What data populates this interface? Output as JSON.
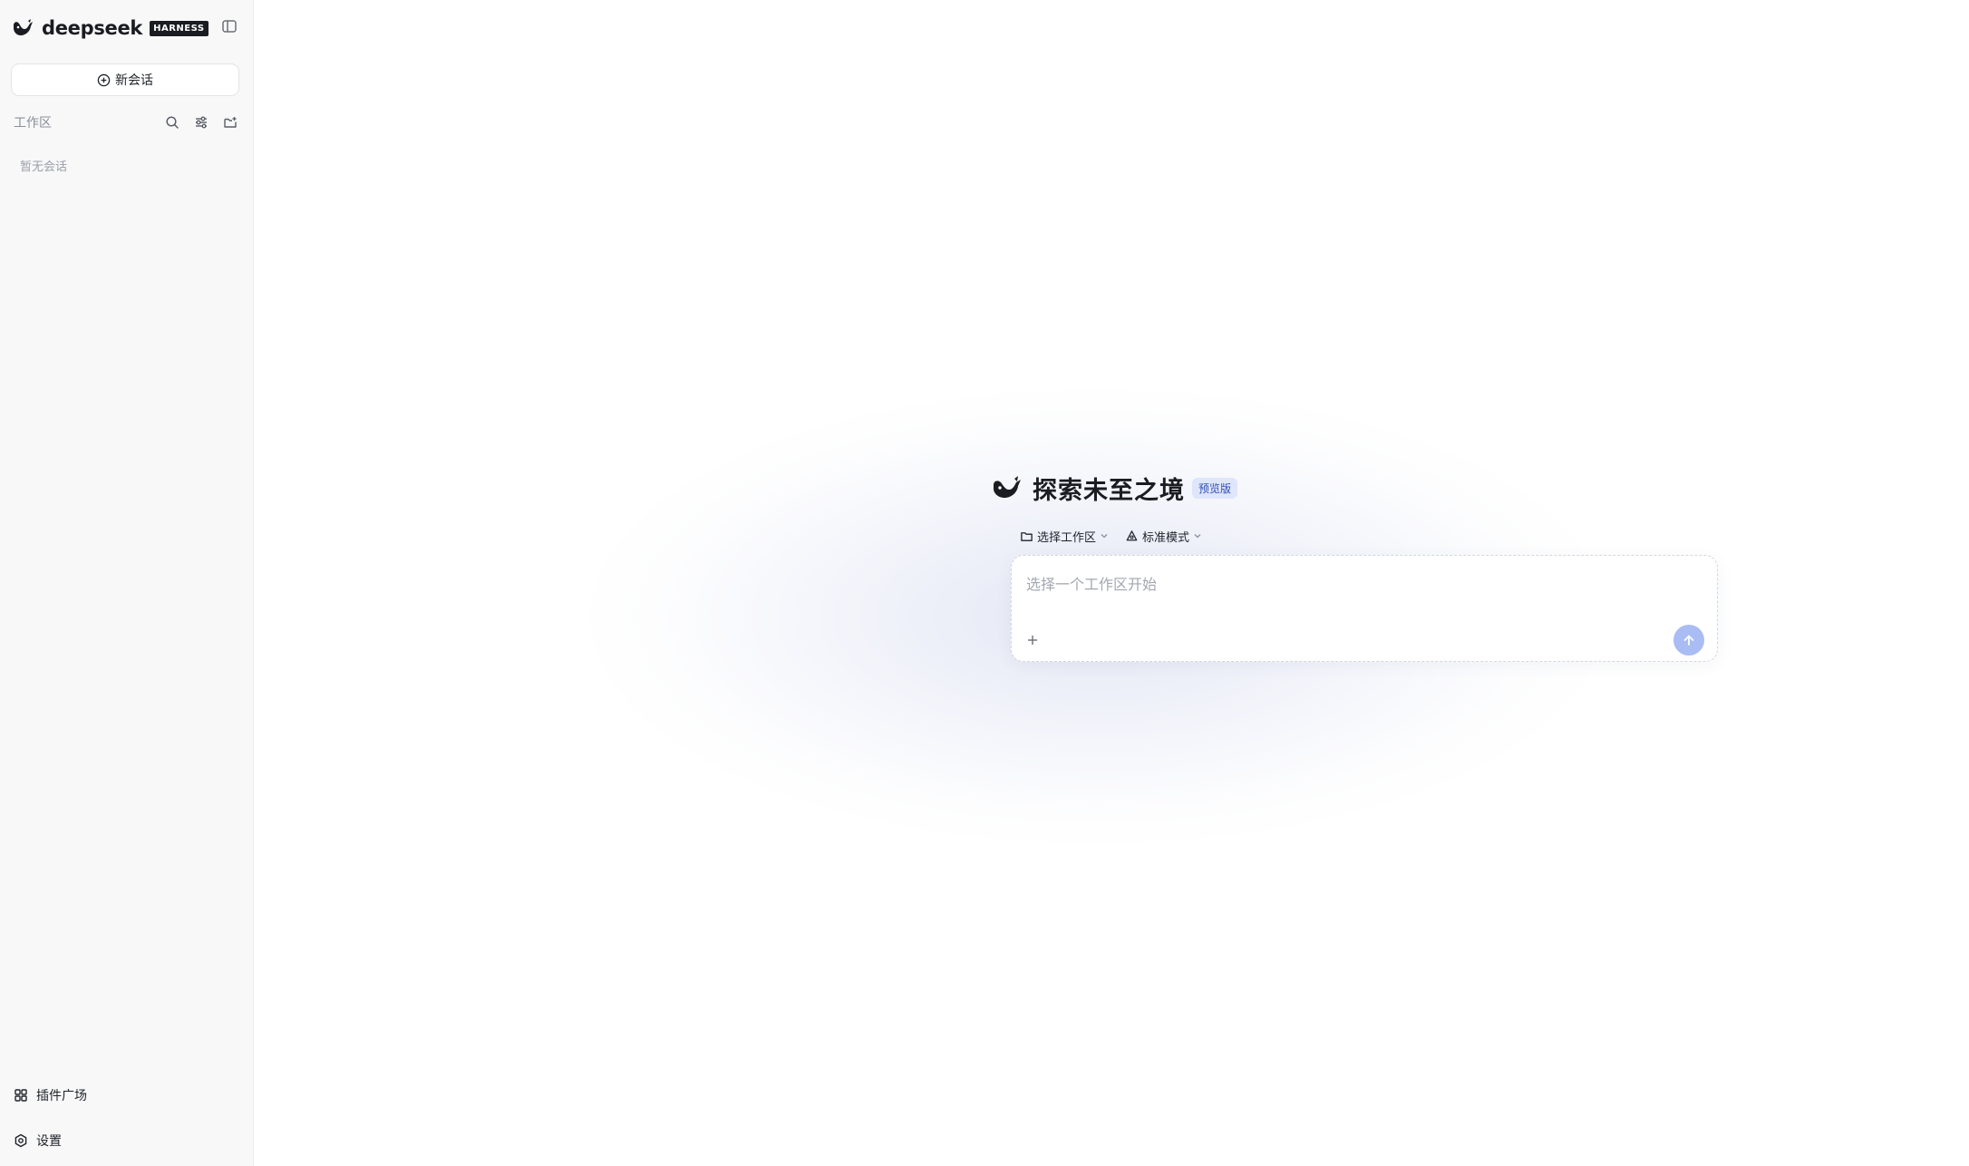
{
  "sidebar": {
    "brand_name": "deepseek",
    "brand_badge": "HARNESS",
    "new_chat_label": "新会话",
    "workspace_label": "工作区",
    "empty_chats_text": "暂无会话",
    "bottom_items": [
      {
        "label": "插件广场",
        "icon": "grid-icon"
      },
      {
        "label": "设置",
        "icon": "settings-gear-icon"
      }
    ]
  },
  "main": {
    "hero_title": "探索未至之境",
    "hero_badge": "预览版",
    "workspace_selector_label": "选择工作区",
    "mode_selector_label": "标准模式",
    "composer_placeholder": "选择一个工作区开始"
  },
  "colors": {
    "sidebar_bg": "#f8f8f9",
    "accent_send": "#a9bcf3",
    "badge_bg": "#dfe6fb",
    "badge_text": "#2f4fb5"
  }
}
